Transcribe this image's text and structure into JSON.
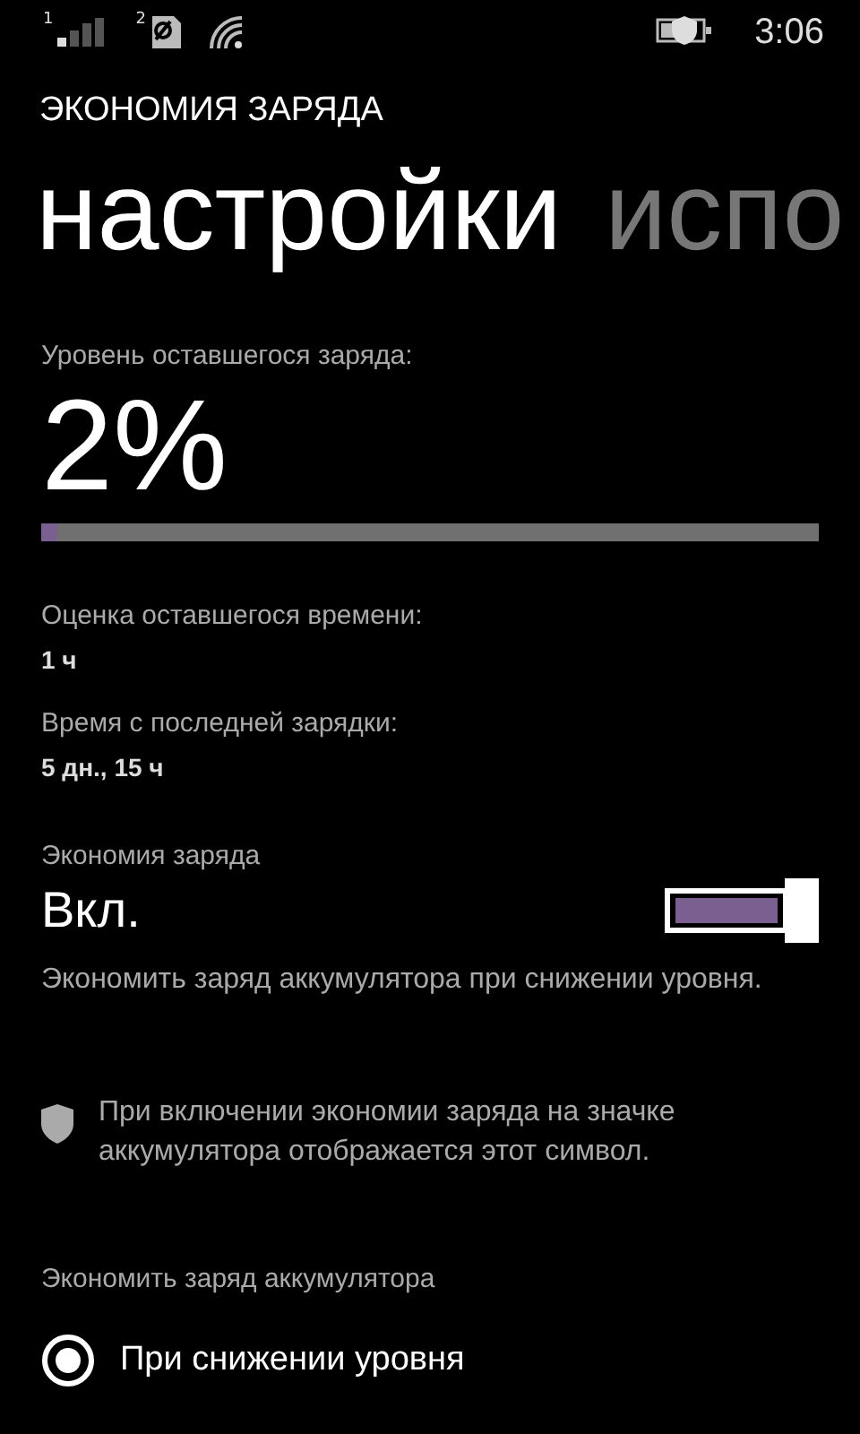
{
  "status_bar": {
    "time": "3:06",
    "sim_1": "1",
    "sim_2": "2"
  },
  "app_title": "ЭКОНОМИЯ ЗАРЯДА",
  "pivots": [
    {
      "label": "настройки",
      "selected": true
    },
    {
      "label": "испо",
      "selected": false
    }
  ],
  "battery": {
    "label": "Уровень оставшегося заряда:",
    "value": "2%",
    "level": 0.02
  },
  "info": [
    {
      "label": "Оценка оставшегося времени:",
      "value": "1 ч"
    },
    {
      "label": "Время с последней зарядки:",
      "value": "5 дн., 15 ч"
    }
  ],
  "saver": {
    "label": "Экономия заряда",
    "state_text": "Вкл.",
    "on": true,
    "description": "Экономить заряд аккумулятора при снижении уровня."
  },
  "note": "При включении экономии заряда на значке аккумулятора отображается этот символ.",
  "mode": {
    "label": "Экономить заряд аккумулятора",
    "options": [
      {
        "label": "При снижении уровня",
        "selected": true
      }
    ]
  }
}
